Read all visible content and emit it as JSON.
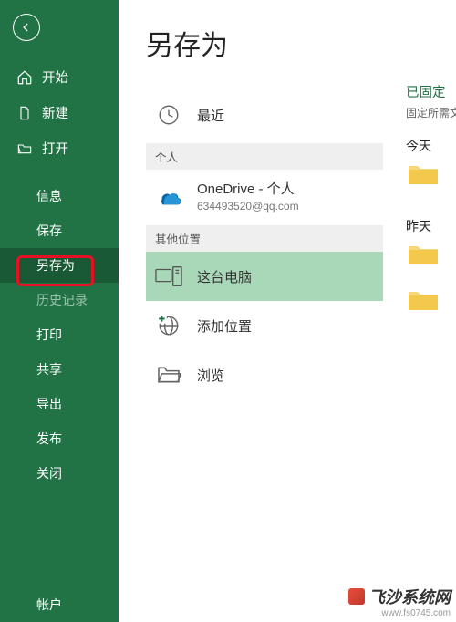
{
  "sidebar": {
    "top": [
      {
        "label": "开始",
        "icon": "home"
      },
      {
        "label": "新建",
        "icon": "file"
      },
      {
        "label": "打开",
        "icon": "folder-open"
      }
    ],
    "mid": [
      {
        "label": "信息"
      },
      {
        "label": "保存"
      },
      {
        "label": "另存为",
        "selected": true
      },
      {
        "label": "历史记录",
        "disabled": true
      },
      {
        "label": "打印"
      },
      {
        "label": "共享"
      },
      {
        "label": "导出"
      },
      {
        "label": "发布"
      },
      {
        "label": "关闭"
      }
    ],
    "bottom": [
      {
        "label": "帐户"
      }
    ]
  },
  "page": {
    "title": "另存为"
  },
  "locations": {
    "recent": {
      "label": "最近"
    },
    "personal_header": "个人",
    "onedrive": {
      "label": "OneDrive - 个人",
      "sub": "634493520@qq.com"
    },
    "other_header": "其他位置",
    "thispc": {
      "label": "这台电脑"
    },
    "addloc": {
      "label": "添加位置"
    },
    "browse": {
      "label": "浏览"
    }
  },
  "right": {
    "pinned": "已固定",
    "pinned_sub": "固定所需文",
    "today": "今天",
    "yesterday": "昨天"
  },
  "watermark": {
    "name": "飞沙系统网",
    "url": "www.fs0745.com"
  }
}
